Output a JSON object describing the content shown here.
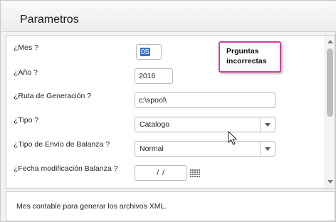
{
  "window": {
    "title": "Parametros"
  },
  "form": {
    "mes": {
      "label": "¿Mes ?",
      "value": "05"
    },
    "anio": {
      "label": "¿Año ?",
      "value": "2016"
    },
    "ruta": {
      "label": "¿Ruta de Generación ?",
      "value": "c:\\spool\\"
    },
    "tipo": {
      "label": "¿Tipo ?",
      "value": "Catalogo"
    },
    "tipo_envio": {
      "label": "¿Tipo de Envío de Balanza ?",
      "value": "Normal"
    },
    "fecha_modificacion": {
      "label": "¿Fecha modificación Balanza ?",
      "value": "/ /"
    }
  },
  "annotation": {
    "line1": "Prguntas",
    "line2": "incorrectas",
    "border_color": "#d53c9a"
  },
  "description": {
    "text": "Mes contable para generar los archivos XML."
  },
  "icons": {
    "calendar": "calendar-grid-icon",
    "select_arrow": "chevron-down-icon",
    "cursor": "mouse-pointer-icon"
  },
  "colors": {
    "selection": "#3b73c8"
  }
}
